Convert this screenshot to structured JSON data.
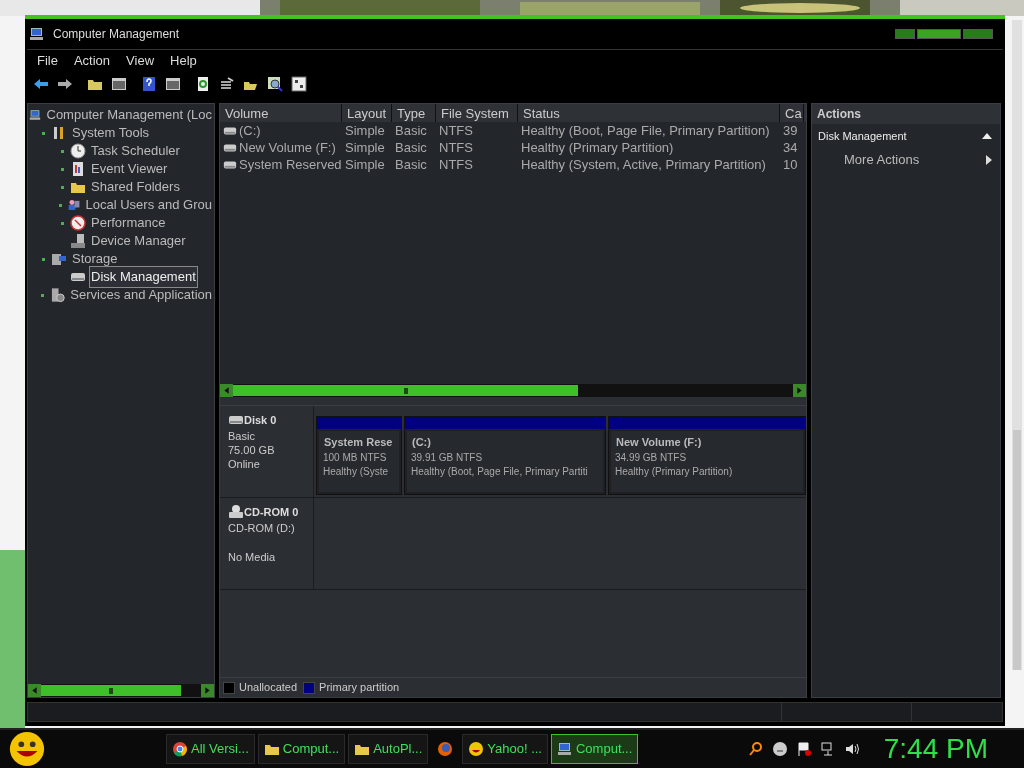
{
  "window": {
    "title": "Computer Management"
  },
  "menu": [
    "File",
    "Action",
    "View",
    "Help"
  ],
  "tree": [
    {
      "label": "Computer Management (Loc",
      "kind": "computer",
      "selected": false,
      "expandable": false,
      "children": [
        {
          "label": "System Tools",
          "kind": "tools",
          "selected": false,
          "expandable": true,
          "children": [
            {
              "label": "Task Scheduler",
              "kind": "clock",
              "selected": false,
              "expandable": true
            },
            {
              "label": "Event Viewer",
              "kind": "log",
              "selected": false,
              "expandable": true
            },
            {
              "label": "Shared Folders",
              "kind": "folder",
              "selected": false,
              "expandable": true
            },
            {
              "label": "Local Users and Grou",
              "kind": "users",
              "selected": false,
              "expandable": true
            },
            {
              "label": "Performance",
              "kind": "gauge",
              "selected": false,
              "expandable": true
            },
            {
              "label": "Device Manager",
              "kind": "device",
              "selected": false,
              "expandable": false
            }
          ]
        },
        {
          "label": "Storage",
          "kind": "storage",
          "selected": false,
          "expandable": true,
          "children": [
            {
              "label": "Disk Management",
              "kind": "disk",
              "selected": true,
              "expandable": false
            }
          ]
        },
        {
          "label": "Services and Application",
          "kind": "services",
          "selected": false,
          "expandable": true
        }
      ]
    }
  ],
  "table": {
    "columns": [
      "Volume",
      "Layout",
      "Type",
      "File System",
      "Status",
      "Ca"
    ],
    "rows": [
      [
        "(C:)",
        "Simple",
        "Basic",
        "NTFS",
        "Healthy (Boot, Page File, Primary Partition)",
        "39"
      ],
      [
        "New Volume (F:)",
        "Simple",
        "Basic",
        "NTFS",
        "Healthy (Primary Partition)",
        "34"
      ],
      [
        "System Reserved",
        "Simple",
        "Basic",
        "NTFS",
        "Healthy (System, Active, Primary Partition)",
        "10"
      ]
    ]
  },
  "disks": [
    {
      "kind": "disk",
      "name": "Disk 0",
      "lines": [
        "Basic",
        "75.00 GB",
        "Online"
      ],
      "partitions": [
        {
          "name": "System Rese",
          "size": "100 MB NTFS",
          "status": "Healthy (Syste"
        },
        {
          "name": "(C:)",
          "size": "39.91 GB NTFS",
          "status": "Healthy (Boot, Page File, Primary Partiti"
        },
        {
          "name": "New Volume  (F:)",
          "size": "34.99 GB NTFS",
          "status": "Healthy (Primary Partition)"
        }
      ]
    },
    {
      "kind": "cdrom",
      "name": "CD-ROM 0",
      "lines": [
        "CD-ROM (D:)",
        "No Media"
      ]
    }
  ],
  "legend": [
    {
      "label": "Unallocated",
      "color": "#000000"
    },
    {
      "label": "Primary partition",
      "color": "#000080"
    }
  ],
  "actions": {
    "title": "Actions",
    "items": [
      {
        "kind": "section",
        "label": "Disk Management",
        "expanded": true
      },
      {
        "kind": "submenu",
        "label": "More Actions"
      }
    ]
  },
  "taskbar": {
    "items": [
      {
        "kind": "browser",
        "label": "All Versi...",
        "selected": false
      },
      {
        "kind": "folder",
        "label": "Comput...",
        "selected": false
      },
      {
        "kind": "folder",
        "label": "AutoPl...",
        "selected": false
      },
      {
        "kind": "firefox",
        "selected": false
      },
      {
        "kind": "messenger",
        "label": "Yahoo! ...",
        "selected": false
      },
      {
        "kind": "computer",
        "label": "Comput...",
        "selected": true
      }
    ],
    "clock": "7:44 PM"
  }
}
